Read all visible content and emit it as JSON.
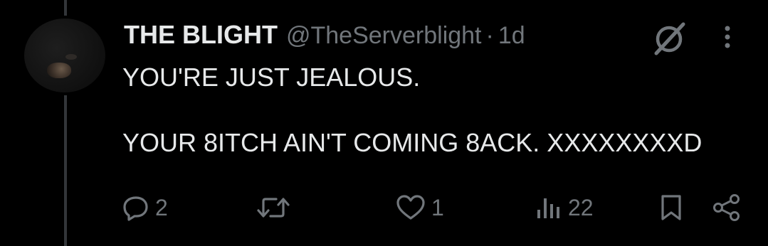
{
  "tweet": {
    "display_name": "THE BLIGHT",
    "handle": "@TheServerblight",
    "separator": "·",
    "time": "1d",
    "text_line_1": "YOU'RE JUST JEALOUS.",
    "text_line_2": "YOUR 8ITCH AIN'T COMING 8ACK. XXXXXXXXD"
  },
  "actions": {
    "replies": "2",
    "retweets": "",
    "likes": "1",
    "views": "22"
  },
  "icons": {
    "reply": "reply-icon",
    "retweet": "retweet-icon",
    "like": "like-icon",
    "views": "views-icon",
    "bookmark": "bookmark-icon",
    "share": "share-icon",
    "grok": "grok-icon",
    "more": "more-icon"
  },
  "colors": {
    "background": "#000000",
    "text_primary": "#e7e9ea",
    "text_secondary": "#71767b",
    "thread_line": "#333639"
  }
}
